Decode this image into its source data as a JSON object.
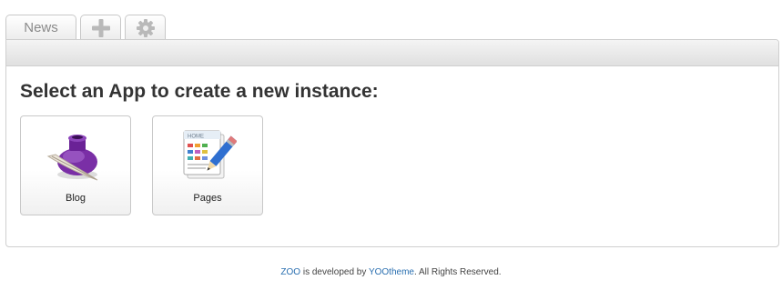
{
  "tabs": {
    "news_label": "News",
    "add_icon": "plus-icon",
    "settings_icon": "gear-icon"
  },
  "main": {
    "heading": "Select an App to create a new instance:",
    "apps": [
      {
        "label": "Blog",
        "icon": "inkwell-quill-icon"
      },
      {
        "label": "Pages",
        "icon": "pages-pencil-icon"
      }
    ]
  },
  "footer": {
    "zoo_link": "ZOO",
    "text_middle": " is developed by ",
    "yootheme_link": "YOOtheme",
    "text_end": ". All Rights Reserved."
  },
  "colors": {
    "link": "#2a6fb0",
    "heading": "#333333",
    "ink_purple": "#7a2fa6"
  }
}
